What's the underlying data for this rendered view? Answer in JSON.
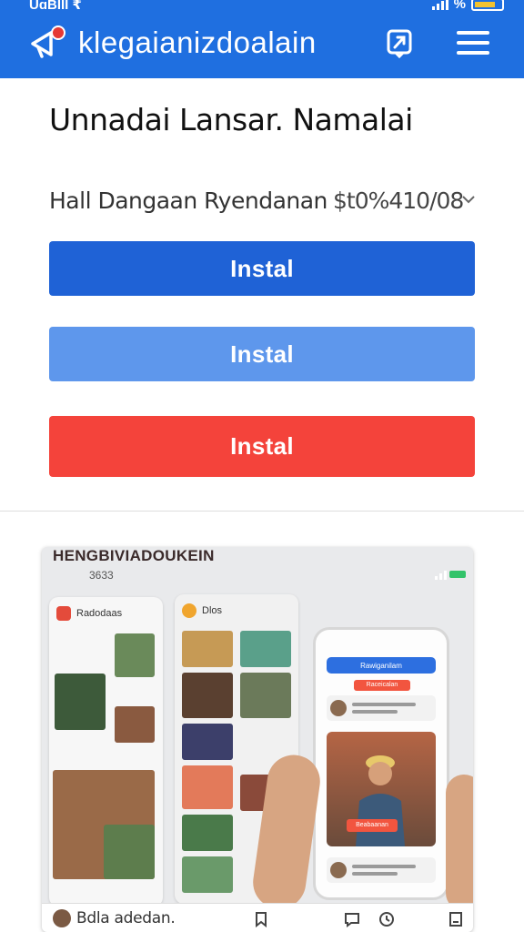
{
  "status_bar": {
    "left_text": "UɑBIII ₹",
    "right_text": "%",
    "signal_icon": "signal-icon",
    "battery_icon": "battery-icon"
  },
  "app_bar": {
    "title": "klegaianizdoalain",
    "brand_icon": "megaphone-icon",
    "notification_dot": "0",
    "share_icon": "share-icon",
    "menu_icon": "hamburger-menu-icon",
    "color": "#1f6fe0"
  },
  "main": {
    "heading": "Unnadai Lansar. Namalai",
    "select": {
      "label": "Hall Dangaan Ryendanan",
      "price": "$t0%410/08",
      "chevron": "chevron-down-icon"
    },
    "buttons": [
      {
        "label": "Instal",
        "color": "#1f62d6"
      },
      {
        "label": "Instal",
        "color": "#5e97ec"
      },
      {
        "label": "Instal",
        "color": "#f4433b"
      }
    ]
  },
  "preview_card": {
    "title": "HENGBIVIADOUKEIN",
    "subtitle": "3633",
    "panel_left_label": "Radodaas",
    "panel_mid_label": "Dlos",
    "phone_header": "Rawiganilam",
    "phone_cta_top": "Raceicalan",
    "phone_cta_bottom": "Beabaanan",
    "footer": {
      "name": "Bdla adedan.",
      "icons": [
        "bookmark-icon",
        "chat-icon",
        "clock-icon",
        "save-icon"
      ]
    }
  }
}
